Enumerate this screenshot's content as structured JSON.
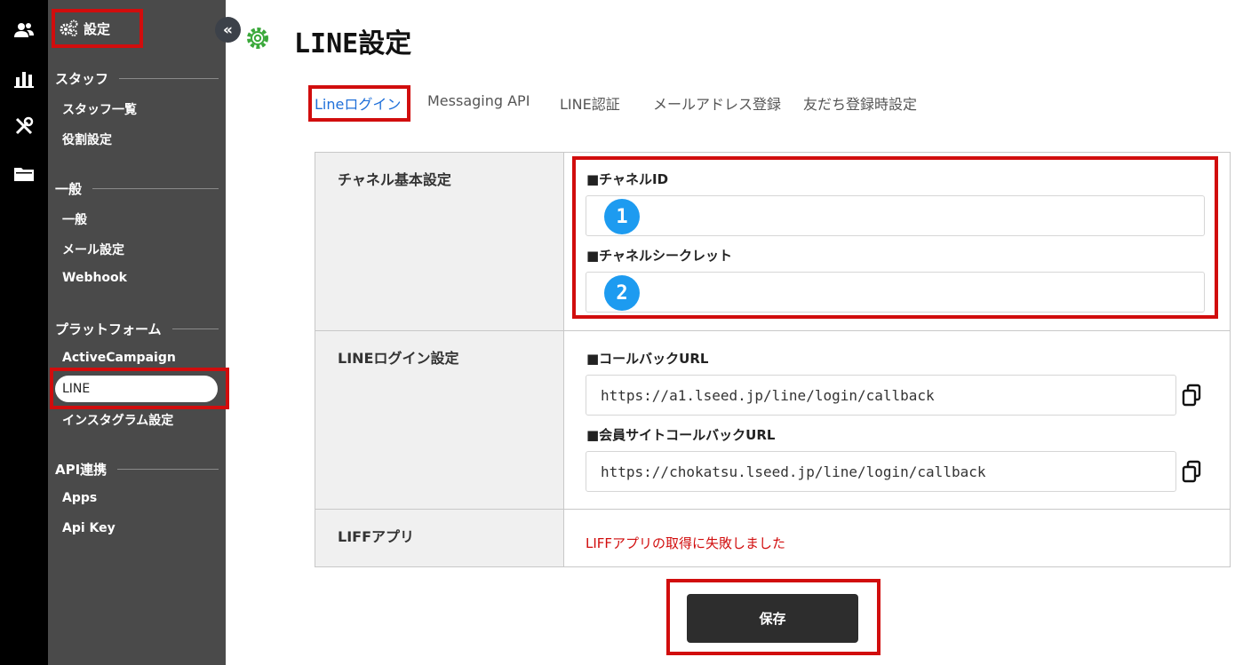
{
  "rail": {
    "icons": [
      "users-icon",
      "chart-icon",
      "tools-icon",
      "folder-icon"
    ]
  },
  "sidebar": {
    "header": "設定",
    "sections": [
      {
        "title": "スタッフ",
        "items": [
          "スタッフ一覧",
          "役割設定"
        ]
      },
      {
        "title": "一般",
        "items": [
          "一般",
          "メール設定",
          "Webhook"
        ]
      },
      {
        "title": "プラットフォーム",
        "items": [
          "ActiveCampaign",
          "LINE",
          "インスタグラム設定"
        ]
      },
      {
        "title": "API連携",
        "items": [
          "Apps",
          "Api Key"
        ]
      }
    ],
    "active_item": "LINE"
  },
  "collapse_label": "«",
  "page": {
    "title": "LINE設定"
  },
  "tabs": [
    {
      "label": "Lineログイン",
      "active": true
    },
    {
      "label": "Messaging API",
      "active": false
    },
    {
      "label": "LINE認証",
      "active": false
    },
    {
      "label": "メールアドレス登録",
      "active": false
    },
    {
      "label": "友だち登録時設定",
      "active": false
    }
  ],
  "table": {
    "channel": {
      "label": "チャネル基本設定",
      "channel_id_label": "■チャネルID",
      "channel_id_value": "",
      "channel_id_badge": "1",
      "channel_secret_label": "■チャネルシークレット",
      "channel_secret_value": "",
      "channel_secret_badge": "2"
    },
    "login": {
      "label": "LINEログイン設定",
      "callback_label": "■コールバックURL",
      "callback_value": "https://a1.lseed.jp/line/login/callback",
      "member_callback_label": "■会員サイトコールバックURL",
      "member_callback_value": "https://chokatsu.lseed.jp/line/login/callback"
    },
    "liff": {
      "label": "LIFFアプリ",
      "error": "LIFFアプリの取得に失敗しました"
    }
  },
  "save_label": "保存",
  "colors": {
    "highlight_red": "#d10d0d",
    "active_tab": "#1e6fd9",
    "badge": "#1d9bf0",
    "error": "#d10d0d"
  }
}
